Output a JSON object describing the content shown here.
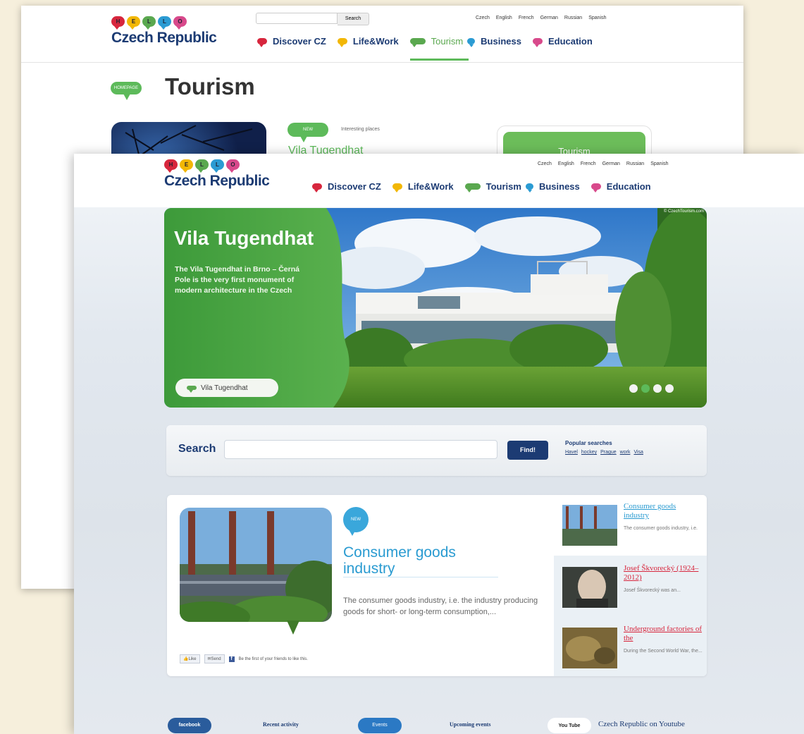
{
  "brand": {
    "logo_letters": [
      "H",
      "E",
      "L",
      "L",
      "O"
    ],
    "logo_text": "Czech Republic"
  },
  "languages": [
    "Czech",
    "English",
    "French",
    "German",
    "Russian",
    "Spanish"
  ],
  "nav": [
    {
      "label": "Discover CZ",
      "color": "#d7263d"
    },
    {
      "label": "Life&Work",
      "color": "#f2b705"
    },
    {
      "label": "Tourism",
      "color": "#5aa84f"
    },
    {
      "label": "Business",
      "color": "#2b9bd3"
    },
    {
      "label": "Education",
      "color": "#d8498b"
    }
  ],
  "back_page": {
    "search_placeholder": "",
    "search_button": "Search",
    "page_title": "Tourism",
    "homepage_tag": "HOMEPAGE",
    "new_tag": "NEW",
    "category": "Interesting places",
    "article_title": "Vila Tugendhat",
    "right_box": "Tourism"
  },
  "hero": {
    "title": "Vila Tugendhat",
    "text": "The Vila Tugendhat in Brno – Černá Pole is the very first monument of modern architecture in the Czech",
    "button": "Vila Tugendhat",
    "credit": "© CzechTourism.com",
    "slides": 4,
    "active_slide": 2
  },
  "search": {
    "label": "Search",
    "value": "",
    "button": "Find!",
    "popular_title": "Popular searches",
    "popular": [
      "Havel",
      "hockey",
      "Prague",
      "work",
      "Visa"
    ]
  },
  "featured": {
    "tag": "NEW",
    "title": "Consumer goods industry",
    "text": "The consumer goods industry, i.e. the industry producing goods for short- or long-term consumption,...",
    "like": "Like",
    "send": "Send",
    "fb_text": "Be the first of your friends to like this."
  },
  "side": [
    {
      "title": "Consumer goods industry",
      "desc": "The consumer goods industry, i.e.",
      "color": "#2a9bd1"
    },
    {
      "title": "Josef Škvorecký (1924–2012)",
      "desc": "Josef Škvorecký was an...",
      "color": "#d7263d"
    },
    {
      "title": "Underground factories of the",
      "desc": "During the Second World War, the...",
      "color": "#d7263d"
    }
  ],
  "footer": {
    "facebook": "facebook",
    "recent": "Recent activity",
    "events": "Events",
    "upcoming": "Upcoming events",
    "youtube_logo": "You Tube",
    "youtube_text": "Czech Republic on Youtube"
  },
  "colors": {
    "accent_green": "#5dba5a",
    "navy": "#1c3b73",
    "link_blue": "#2a9bd1",
    "red": "#d7263d"
  }
}
